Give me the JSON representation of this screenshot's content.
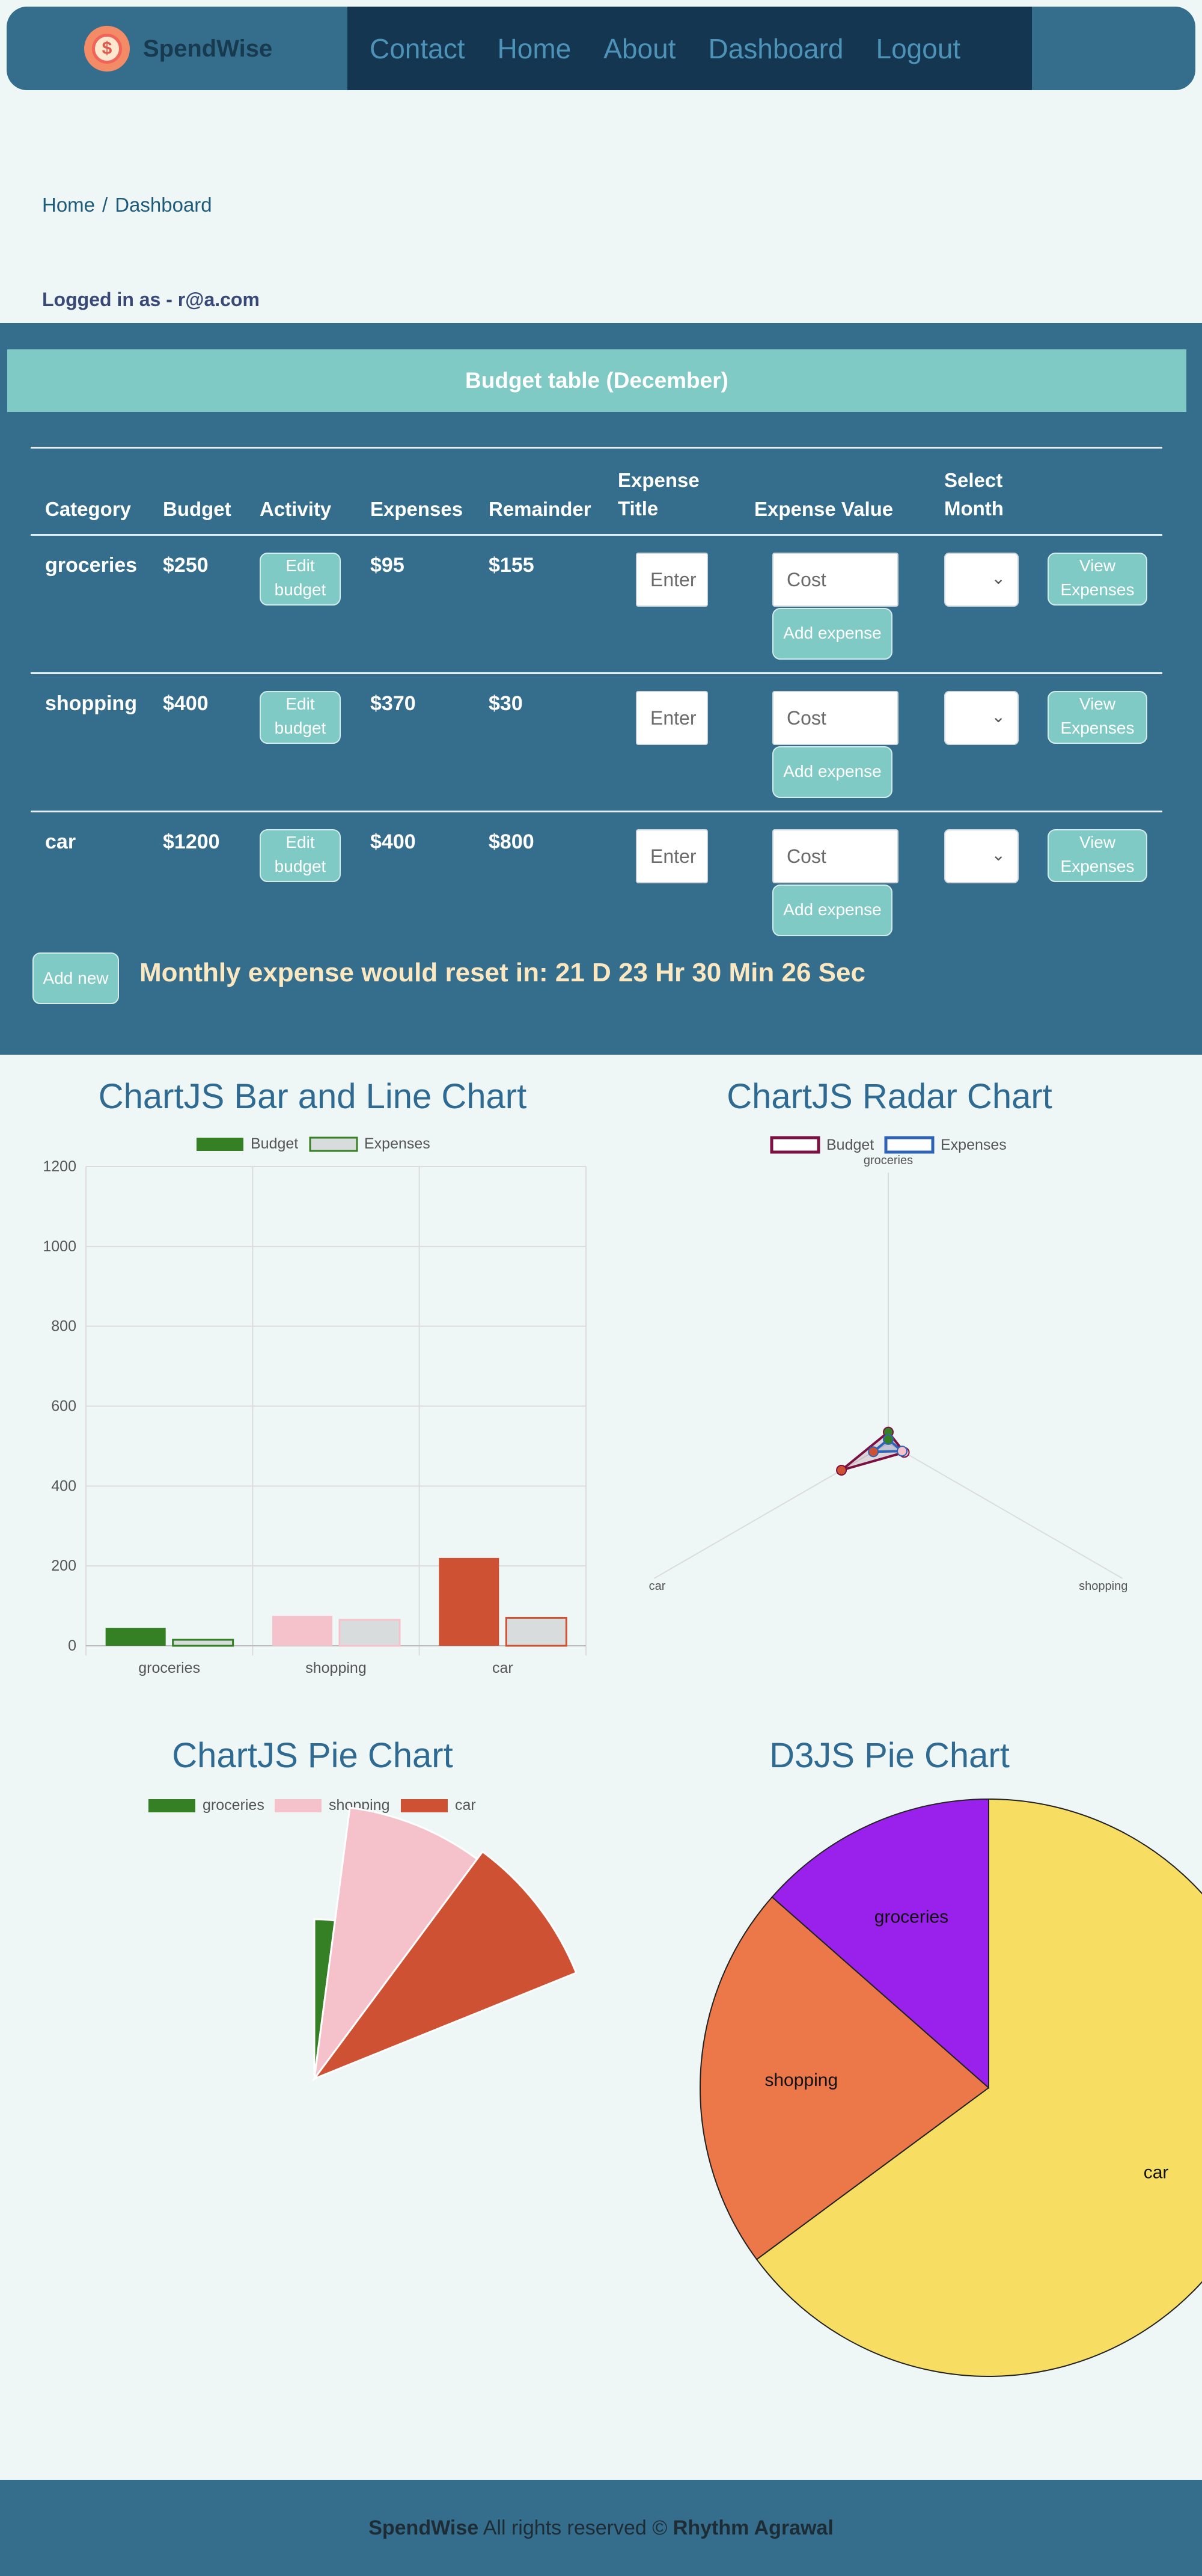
{
  "app": {
    "name": "SpendWise"
  },
  "nav": {
    "links": [
      "Contact",
      "Home",
      "About",
      "Dashboard",
      "Logout"
    ]
  },
  "breadcrumb": {
    "items": [
      "Home",
      "Dashboard"
    ],
    "separator": "/"
  },
  "user": {
    "login_text": "Logged in as - r@a.com"
  },
  "budget_table": {
    "title": "Budget table (December)",
    "headers": [
      "Category",
      "Budget",
      "Activity",
      "Expenses",
      "Remainder",
      "Expense Title",
      "Expense Value",
      "Select Month",
      ""
    ],
    "rows": [
      {
        "category": "groceries",
        "budget": "$250",
        "expenses": "$95",
        "remainder": "$155"
      },
      {
        "category": "shopping",
        "budget": "$400",
        "expenses": "$370",
        "remainder": "$30"
      },
      {
        "category": "car",
        "budget": "$1200",
        "expenses": "$400",
        "remainder": "$800"
      }
    ],
    "edit_label": "Edit budget",
    "title_placeholder": "Enter",
    "value_placeholder": "Cost",
    "add_expense_label": "Add expense",
    "view_label": "View Expenses",
    "add_new_label": "Add new",
    "reset_text": "Monthly expense would reset in: 21 D 23 Hr 30 Min 26 Sec"
  },
  "colors": {
    "header": "#356d8c",
    "accent": "#7fcac4",
    "groceries": "#357f24",
    "shopping": "#f5c2cc",
    "car": "#cf5133"
  },
  "chart_data": [
    {
      "type": "bar",
      "title": "ChartJS Bar and Line Chart",
      "categories": [
        "groceries",
        "shopping",
        "car"
      ],
      "series": [
        {
          "name": "Budget",
          "values": [
            45,
            75,
            220
          ]
        },
        {
          "name": "Expenses",
          "values": [
            15,
            65,
            70
          ]
        }
      ],
      "ylim": [
        0,
        1200
      ],
      "yticks": [
        0,
        200,
        400,
        600,
        800,
        1000,
        1200
      ],
      "legend": "top",
      "grid": true
    },
    {
      "type": "radar",
      "title": "ChartJS Radar Chart",
      "categories": [
        "groceries",
        "shopping",
        "car"
      ],
      "series": [
        {
          "name": "Budget",
          "values": [
            45,
            75,
            220
          ]
        },
        {
          "name": "Expenses",
          "values": [
            15,
            65,
            70
          ]
        }
      ],
      "legend": "top"
    },
    {
      "type": "pie",
      "title": "ChartJS Pie Chart",
      "categories": [
        "groceries",
        "shopping",
        "car"
      ],
      "values": [
        95,
        370,
        400
      ],
      "legend": "top"
    },
    {
      "type": "pie",
      "title": "D3JS Pie Chart",
      "categories": [
        "groceries",
        "shopping",
        "car"
      ],
      "values": [
        250,
        400,
        1200
      ]
    }
  ],
  "footer": {
    "brand": "SpendWise",
    "text": " All rights reserved © ",
    "author": "Rhythm Agrawal"
  }
}
